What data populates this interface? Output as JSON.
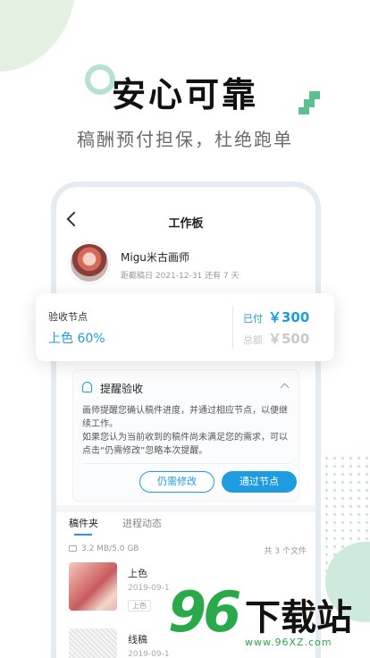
{
  "hero": {
    "title": "安心可靠",
    "subtitle": "稿酬预付担保，杜绝跑单"
  },
  "colors": {
    "accent": "#1f9be0",
    "brand_green": "#5fc08f",
    "watermark_green": "#2aa94b"
  },
  "screen": {
    "title": "工作板",
    "artist": {
      "name": "Migu米古画师",
      "meta": "距截稿日 2021-12-31 还有 7 天"
    },
    "milestone": {
      "label": "验收节点",
      "value": "上色 60%",
      "paid_label": "已付",
      "paid_value": "￥300",
      "total_label": "总额",
      "total_value": "￥500"
    },
    "reminder": {
      "title": "提醒验收",
      "text1": "画师提醒您确认稿件进度，并通过相应节点，以便继续工作。",
      "text2": "如果您认为当前收到的稿件尚未满足您的需求，可以点击“仍需修改”忽略本次提醒。",
      "modify_label": "仍需修改",
      "pass_label": "通过节点"
    },
    "tabs": [
      {
        "label": "稿件夹"
      },
      {
        "label": "进程动态"
      }
    ],
    "storage": "3.2 MB/5.0 GB",
    "file_count": "共 3 个文件",
    "files": [
      {
        "name": "上色",
        "date": "2019-09-1",
        "tag": "上色"
      },
      {
        "name": "线稿",
        "date": "2019-09-1"
      }
    ]
  },
  "watermark": {
    "number": "96",
    "name": "下载站",
    "url": "www.96XZ.com"
  }
}
